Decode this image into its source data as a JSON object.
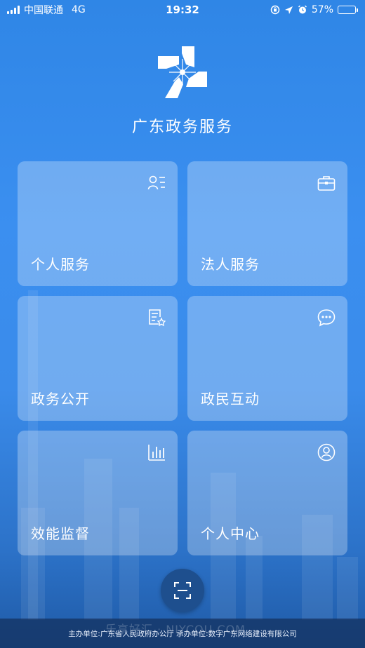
{
  "status_bar": {
    "carrier": "中国联通",
    "network": "4G",
    "time": "19:32",
    "battery_percent": "57%",
    "battery_level": 0.57
  },
  "app": {
    "title": "广东政务服务"
  },
  "tiles": [
    {
      "label": "个人服务",
      "icon": "person-list-icon"
    },
    {
      "label": "法人服务",
      "icon": "briefcase-icon"
    },
    {
      "label": "政务公开",
      "icon": "document-star-icon"
    },
    {
      "label": "政民互动",
      "icon": "chat-bubble-icon"
    },
    {
      "label": "效能监督",
      "icon": "bar-chart-icon"
    },
    {
      "label": "个人中心",
      "icon": "user-circle-icon"
    }
  ],
  "scan": {
    "icon": "scan-icon"
  },
  "footer": {
    "text": "主办单位:广东省人民政府办公厅 承办单位:数字广东网络建设有限公司",
    "watermark": "乐享好汇 · NIYCOU.COM"
  },
  "colors": {
    "background": "#3a8bea",
    "tile": "rgba(255,255,255,0.28)",
    "scan_button": "#1e4f8e"
  }
}
